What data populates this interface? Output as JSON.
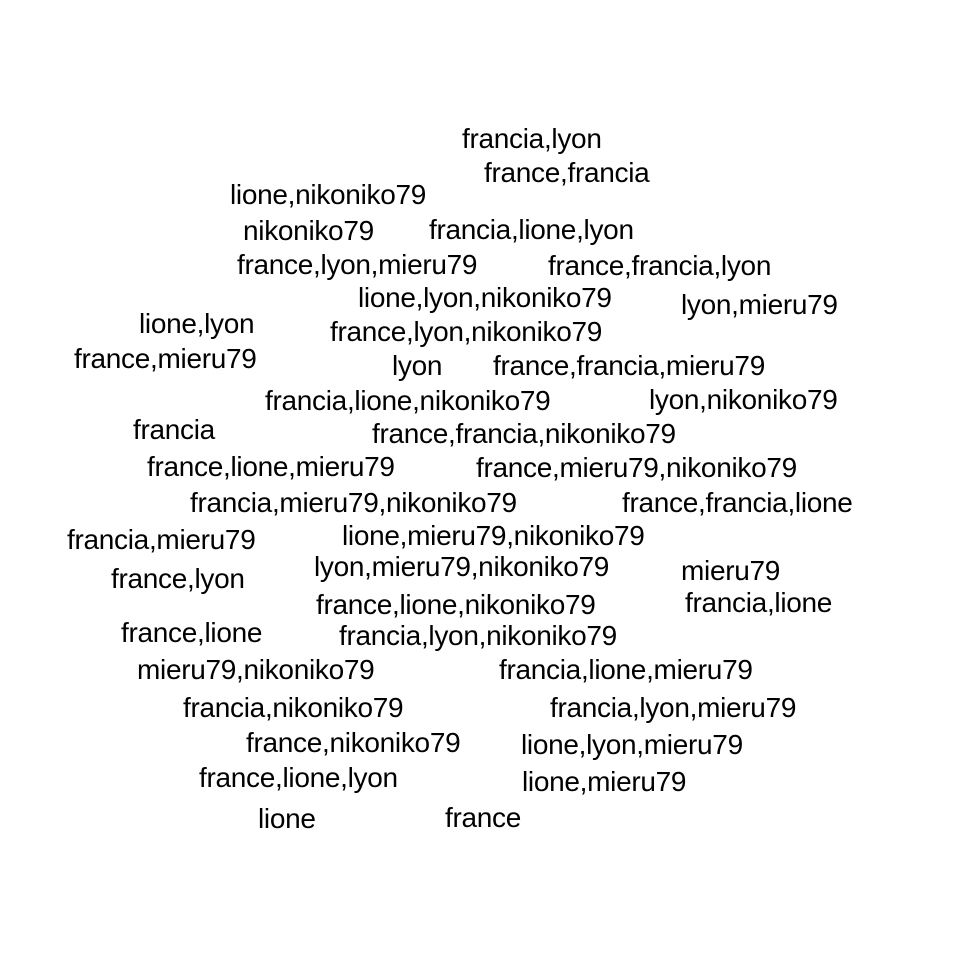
{
  "background": "#ffffff",
  "text_color": "#000000",
  "words": [
    "francia,lyon",
    "france,francia",
    "lione,nikoniko79",
    "nikoniko79",
    "francia,lione,lyon",
    "france,lyon,mieru79",
    "france,francia,lyon",
    "lione,lyon,nikoniko79",
    "lyon,mieru79",
    "lione,lyon",
    "france,lyon,nikoniko79",
    "france,mieru79",
    "lyon",
    "france,francia,mieru79",
    "francia,lione,nikoniko79",
    "lyon,nikoniko79",
    "francia",
    "france,francia,nikoniko79",
    "france,lione,mieru79",
    "france,mieru79,nikoniko79",
    "francia,mieru79,nikoniko79",
    "france,francia,lione",
    "francia,mieru79",
    "lione,mieru79,nikoniko79",
    "lyon,mieru79,nikoniko79",
    "mieru79",
    "france,lyon",
    "france,lione,nikoniko79",
    "francia,lione",
    "france,lione",
    "francia,lyon,nikoniko79",
    "mieru79,nikoniko79",
    "francia,lione,mieru79",
    "francia,nikoniko79",
    "francia,lyon,mieru79",
    "france,nikoniko79",
    "lione,lyon,mieru79",
    "france,lione,lyon",
    "lione,mieru79",
    "lione",
    "france"
  ]
}
